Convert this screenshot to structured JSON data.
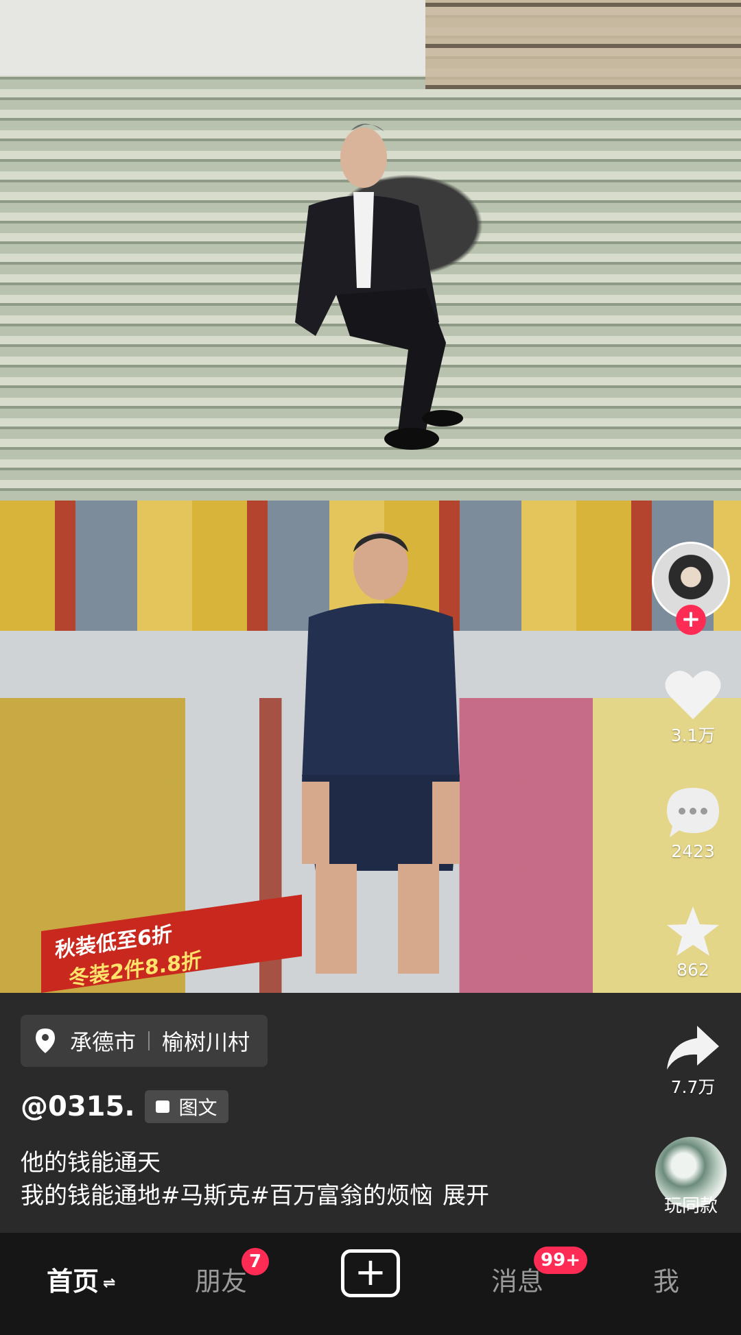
{
  "post": {
    "location_city": "承德市",
    "location_village": "榆树川村",
    "author": "@0315.",
    "type_tag": "图文",
    "desc_line1": "他的钱能通天",
    "desc_line2": "我的钱能通地#马斯克#百万富翁的烦恼",
    "expand_label": "展开"
  },
  "actions": {
    "likes": "3.1万",
    "comments": "2423",
    "favorites": "862",
    "shares": "7.7万",
    "sound_label": "玩同款"
  },
  "photo_text": {
    "banner_line1": "秋装低至6折",
    "banner_line2": "冬装2件8.8折"
  },
  "nav": {
    "home": "首页",
    "home_swap": "⇌",
    "friends": "朋友",
    "friends_badge": "7",
    "messages": "消息",
    "messages_badge": "99+",
    "me": "我",
    "create_icon": "+"
  },
  "colors": {
    "accent": "#fe2c55",
    "nav_bg": "#161616",
    "info_bg": "#2a2a2a"
  }
}
